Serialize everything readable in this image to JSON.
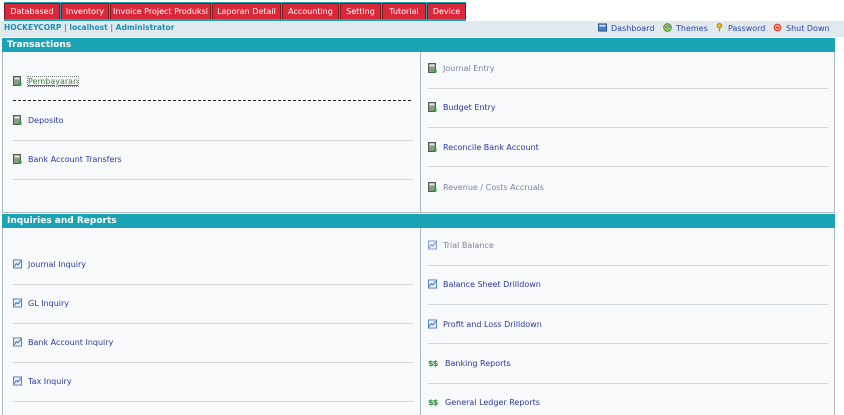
{
  "tabs": [
    "Databased",
    "Inventory",
    "Invoice Project Produksi",
    "Laporan Detail",
    "Accounting",
    "Setting",
    "Tutorial",
    "Device"
  ],
  "company": "HOCKEYCORP | localhost | Administrator",
  "top_links": {
    "dashboard": "Dashboard",
    "themes": "Themes",
    "password": "Password",
    "shutdown": "Shut Down"
  },
  "transactions": {
    "title": "Transactions",
    "left": [
      {
        "label": "Pembayaran",
        "icon": "calculator-icon"
      },
      {
        "label": "Deposito",
        "icon": "calculator-icon"
      },
      {
        "label": "Bank Account Transfers",
        "icon": "calculator-icon"
      }
    ],
    "right": [
      {
        "label": "Journal Entry",
        "icon": "calculator-icon"
      },
      {
        "label": "Budget Entry",
        "icon": "calculator-icon"
      },
      {
        "label": "Reconcile Bank Account",
        "icon": "calculator-icon"
      },
      {
        "label": "Revenue / Costs Accruals",
        "icon": "calculator-icon"
      }
    ]
  },
  "inquiries": {
    "title": "Inquiries and Reports",
    "left": [
      {
        "label": "Journal Inquiry",
        "icon": "chart-icon"
      },
      {
        "label": "GL Inquiry",
        "icon": "chart-icon"
      },
      {
        "label": "Bank Account Inquiry",
        "icon": "chart-icon"
      },
      {
        "label": "Tax Inquiry",
        "icon": "chart-icon"
      }
    ],
    "right": [
      {
        "label": "Trial Balance",
        "icon": "chart-icon"
      },
      {
        "label": "Balance Sheet Drilldown",
        "icon": "chart-icon"
      },
      {
        "label": "Profit and Loss Drilldown",
        "icon": "chart-icon"
      },
      {
        "label": "Banking Reports",
        "icon": "money-icon"
      },
      {
        "label": "General Ledger Reports",
        "icon": "money-icon"
      }
    ]
  }
}
